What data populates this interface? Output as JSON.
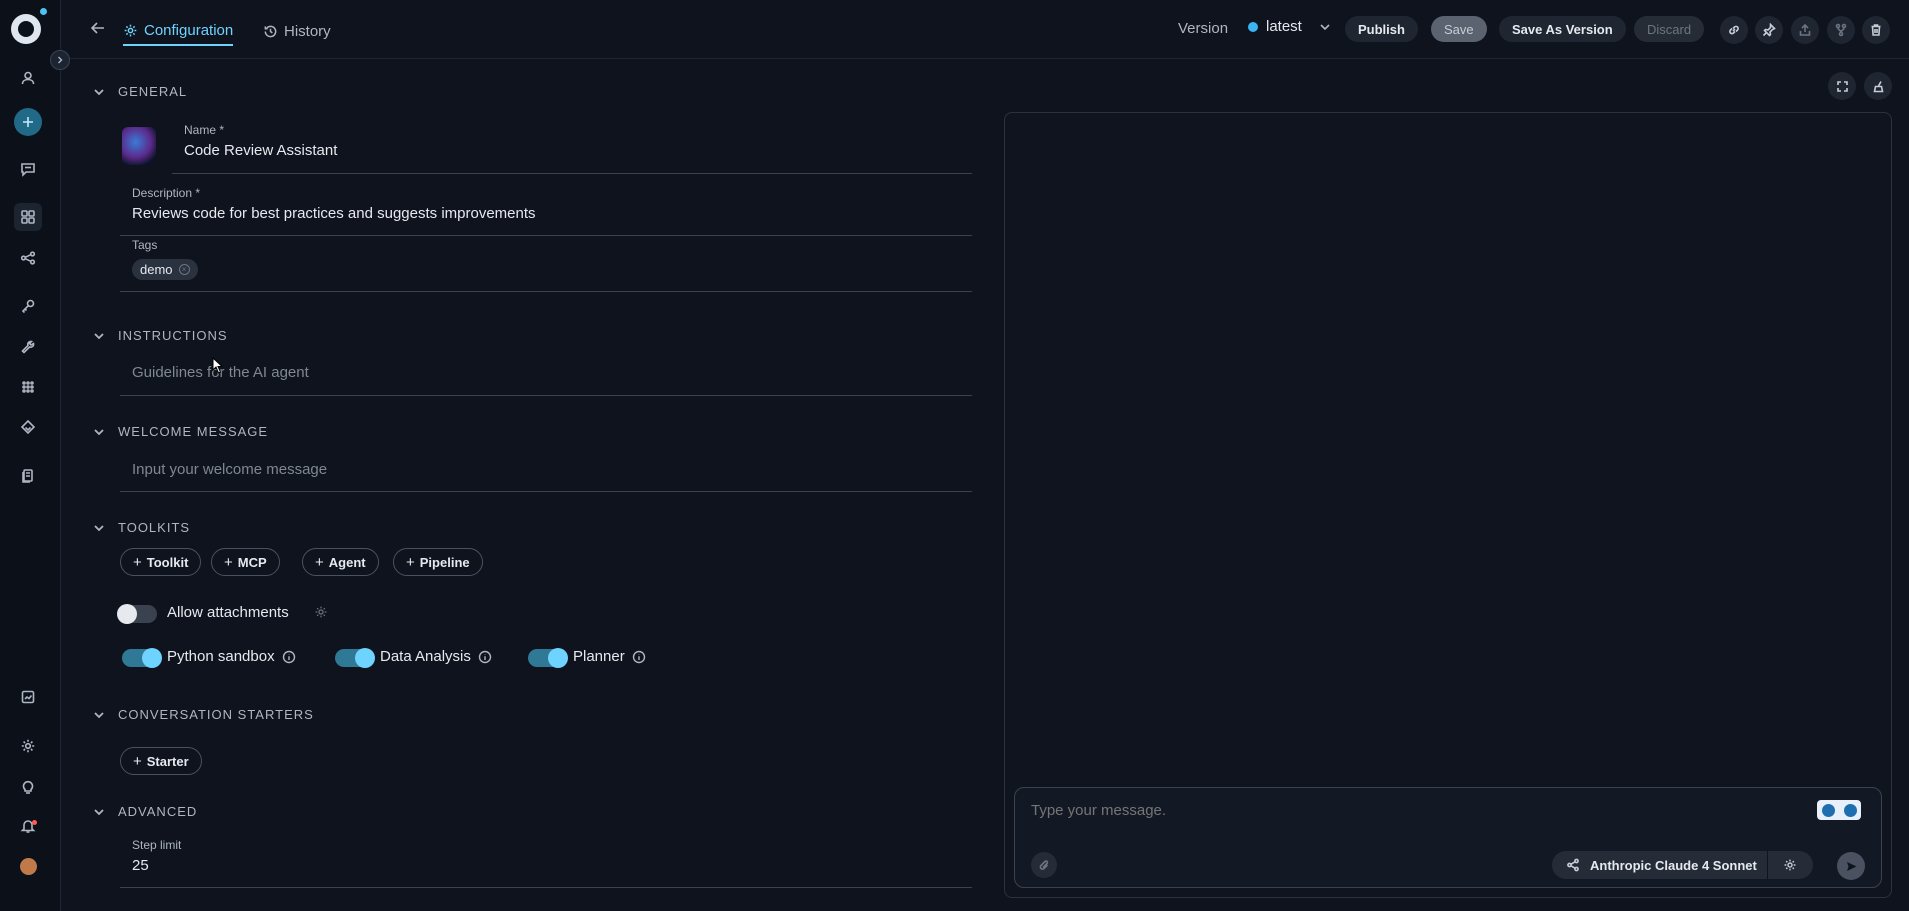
{
  "header": {
    "tabs": [
      {
        "label": "Configuration",
        "active": true
      },
      {
        "label": "History",
        "active": false
      }
    ],
    "version_label": "Version",
    "version_value": "latest",
    "buttons": {
      "publish": "Publish",
      "save": "Save",
      "save_as_version": "Save As Version",
      "discard": "Discard"
    }
  },
  "sections": {
    "general": "GENERAL",
    "instructions": "INSTRUCTIONS",
    "welcome": "WELCOME MESSAGE",
    "toolkits": "TOOLKITS",
    "starters": "CONVERSATION STARTERS",
    "advanced": "ADVANCED"
  },
  "general": {
    "name_label": "Name",
    "name_value": "Code Review Assistant",
    "description_label": "Description",
    "description_value": "Reviews code for best practices and suggests improvements",
    "tags_label": "Tags",
    "tags": [
      "demo"
    ]
  },
  "instructions": {
    "placeholder": "Guidelines for the AI agent"
  },
  "welcome": {
    "placeholder": "Input your welcome message"
  },
  "toolkits": {
    "add_buttons": [
      "Toolkit",
      "MCP",
      "Agent",
      "Pipeline"
    ],
    "allow_attachments": {
      "label": "Allow attachments",
      "enabled": false
    },
    "toggles": [
      {
        "label": "Python sandbox",
        "enabled": true
      },
      {
        "label": "Data Analysis",
        "enabled": true
      },
      {
        "label": "Planner",
        "enabled": true
      }
    ]
  },
  "starters": {
    "add_label": "Starter"
  },
  "advanced": {
    "step_limit_label": "Step limit",
    "step_limit_value": "25"
  },
  "chat": {
    "input_placeholder": "Type your message.",
    "model": "Anthropic Claude 4 Sonnet"
  },
  "colors": {
    "accent": "#6fd3ff",
    "background": "#0e131d",
    "version_dot": "#3ab4f2"
  }
}
